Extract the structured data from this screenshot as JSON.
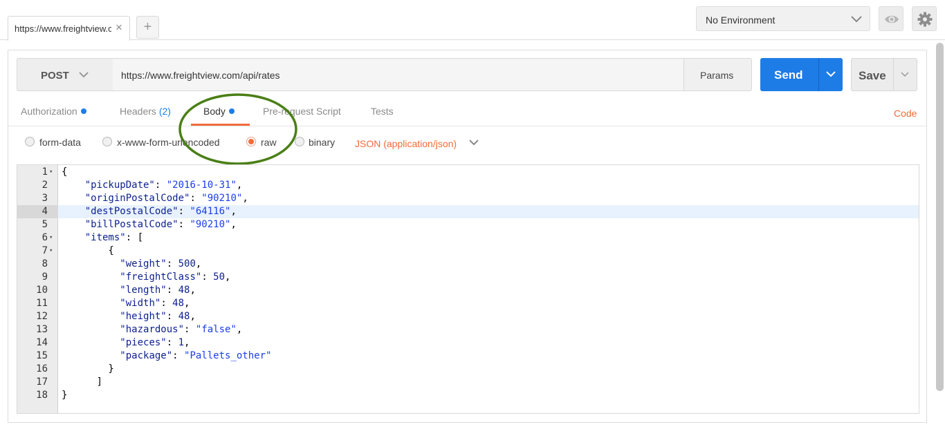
{
  "tabs": [
    {
      "label": "https://www.freightview.com/api/rates",
      "close": "×"
    }
  ],
  "new_tab_label": "+",
  "environment": {
    "selected": "No Environment"
  },
  "icons": {
    "eye": "eye-icon",
    "settings": "gear-icon"
  },
  "request": {
    "method": "POST",
    "url": "https://www.freightview.com/api/rates",
    "params_label": "Params",
    "send_label": "Send",
    "save_label": "Save"
  },
  "request_tabs": [
    {
      "label": "Authorization",
      "dot": true
    },
    {
      "label": "Headers",
      "count": "(2)"
    },
    {
      "label": "Body",
      "dot": true,
      "active": true
    },
    {
      "label": "Pre-request Script"
    },
    {
      "label": "Tests"
    }
  ],
  "code_link": "Code",
  "body_modes": [
    {
      "label": "form-data",
      "selected": false
    },
    {
      "label": "x-www-form-urlencoded",
      "selected": false
    },
    {
      "label": "raw",
      "selected": true
    },
    {
      "label": "binary",
      "selected": false
    }
  ],
  "raw_type": "JSON (application/json)",
  "editor": {
    "active_line": 4,
    "lines": [
      {
        "n": "1",
        "fold": true,
        "text": "{"
      },
      {
        "n": "2",
        "text": "    \"pickupDate\": \"2016-10-31\","
      },
      {
        "n": "3",
        "text": "    \"originPostalCode\": \"90210\","
      },
      {
        "n": "4",
        "text": "    \"destPostalCode\": \"64116\","
      },
      {
        "n": "5",
        "text": "    \"billPostalCode\": \"90210\","
      },
      {
        "n": "6",
        "fold": true,
        "text": "    \"items\": ["
      },
      {
        "n": "7",
        "fold": true,
        "text": "        {"
      },
      {
        "n": "8",
        "text": "          \"weight\": 500,"
      },
      {
        "n": "9",
        "text": "          \"freightClass\": 50,"
      },
      {
        "n": "10",
        "text": "          \"length\": 48,"
      },
      {
        "n": "11",
        "text": "          \"width\": 48,"
      },
      {
        "n": "12",
        "text": "          \"height\": 48,"
      },
      {
        "n": "13",
        "text": "          \"hazardous\": \"false\","
      },
      {
        "n": "14",
        "text": "          \"pieces\": 1,"
      },
      {
        "n": "15",
        "text": "          \"package\": \"Pallets_other\""
      },
      {
        "n": "16",
        "text": "        }"
      },
      {
        "n": "17",
        "text": "      ]"
      },
      {
        "n": "18",
        "text": "}"
      }
    ]
  },
  "colors": {
    "accent": "#f26b3a",
    "send": "#1e7ce6",
    "highlight_circle": "#4a7f16"
  }
}
